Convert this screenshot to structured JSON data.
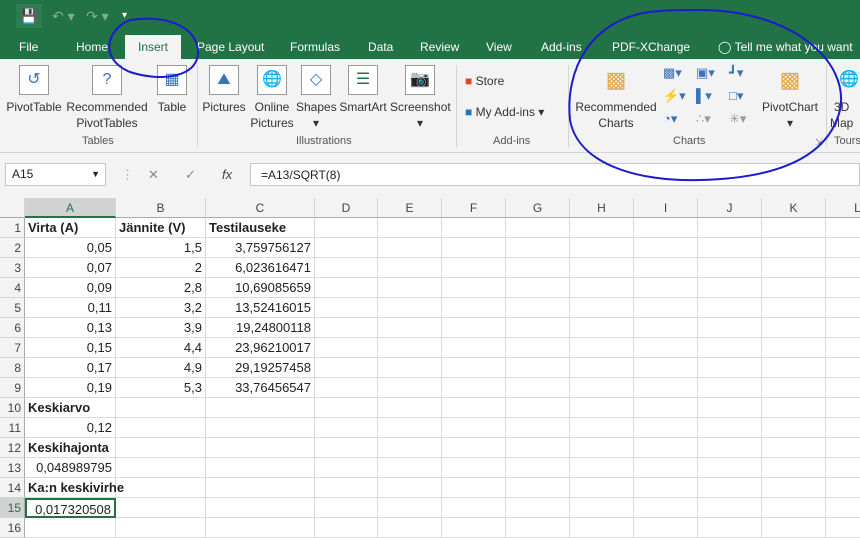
{
  "quick_access": {
    "save_icon": "save-icon",
    "undo_icon": "undo-icon",
    "redo_icon": "redo-icon"
  },
  "tabs": [
    "File",
    "Home",
    "Insert",
    "Page Layout",
    "Formulas",
    "Data",
    "Review",
    "View",
    "Add-ins",
    "PDF-XChange"
  ],
  "active_tab": "Insert",
  "tell_me": "Tell me what you want t",
  "ribbon": {
    "tables": {
      "label": "Tables",
      "pivottable": "PivotTable",
      "recommended1": "Recommended",
      "recommended2": "PivotTables",
      "table": "Table"
    },
    "illustrations": {
      "label": "Illustrations",
      "pictures": "Pictures",
      "online1": "Online",
      "online2": "Pictures",
      "shapes": "Shapes",
      "smartart": "SmartArt",
      "screenshot": "Screenshot"
    },
    "addins": {
      "label": "Add-ins",
      "store": "Store",
      "my_addins": "My Add-ins"
    },
    "charts": {
      "label": "Charts",
      "recommended1": "Recommended",
      "recommended2": "Charts",
      "pivotchart": "PivotChart"
    },
    "tours": {
      "label": "Tours",
      "map1": "3D",
      "map2": "Map"
    }
  },
  "formula_bar": {
    "name_box": "A15",
    "formula": "=A13/SQRT(8)"
  },
  "columns": [
    "A",
    "B",
    "C",
    "D",
    "E",
    "F",
    "G",
    "H",
    "I",
    "J",
    "K",
    "L"
  ],
  "rows": [
    [
      "Virta (A)",
      "Jännite (V)",
      "Testilauseke"
    ],
    [
      "0,05",
      "1,5",
      "3,759756127"
    ],
    [
      "0,07",
      "2",
      "6,023616471"
    ],
    [
      "0,09",
      "2,8",
      "10,69085659"
    ],
    [
      "0,11",
      "3,2",
      "13,52416015"
    ],
    [
      "0,13",
      "3,9",
      "19,24800118"
    ],
    [
      "0,15",
      "4,4",
      "23,96210017"
    ],
    [
      "0,17",
      "4,9",
      "29,19257458"
    ],
    [
      "0,19",
      "5,3",
      "33,76456547"
    ],
    [
      "Keskiarvo",
      "",
      ""
    ],
    [
      "0,12",
      "",
      ""
    ],
    [
      "Keskihajonta",
      "",
      ""
    ],
    [
      "0,048989795",
      "",
      ""
    ],
    [
      "Ka:n keskivirhe",
      "",
      ""
    ],
    [
      "0,017320508",
      "",
      ""
    ],
    [
      "",
      "",
      ""
    ]
  ],
  "colors": {
    "excel_green": "#217346",
    "annotation_blue": "#1a1ad0"
  }
}
